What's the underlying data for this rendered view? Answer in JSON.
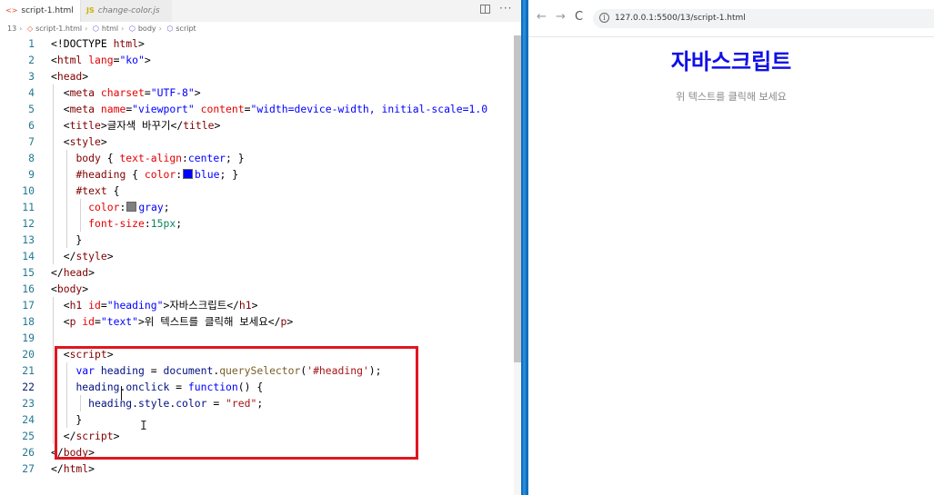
{
  "editor": {
    "tabs": [
      {
        "label": "script-1.html",
        "icon": "html-file-icon",
        "close": "×"
      },
      {
        "label": "change-color.js",
        "icon": "js-file-icon"
      }
    ],
    "breadcrumb": {
      "folder": "13",
      "file": "script-1.html",
      "items": [
        "html",
        "body",
        "script"
      ]
    },
    "active_line": 22,
    "colors": {
      "blue_swatch": "#0000ff",
      "gray_swatch": "#808080",
      "highlight_box": "#e0161f"
    }
  },
  "code_lines": [
    {
      "n": 1,
      "tokens": [
        [
          "p",
          "<!DOCTYPE "
        ],
        [
          "t",
          "html"
        ],
        [
          "p",
          ">"
        ]
      ]
    },
    {
      "n": 2,
      "tokens": [
        [
          "p",
          "<"
        ],
        [
          "t",
          "html"
        ],
        [
          "p",
          " "
        ],
        [
          "a",
          "lang"
        ],
        [
          "p",
          "="
        ],
        [
          "s",
          "\"ko\""
        ],
        [
          "p",
          ">"
        ]
      ]
    },
    {
      "n": 3,
      "tokens": [
        [
          "p",
          "<"
        ],
        [
          "t",
          "head"
        ],
        [
          "p",
          ">"
        ]
      ]
    },
    {
      "n": 4,
      "tokens": [
        [
          "p",
          "  <"
        ],
        [
          "t",
          "meta"
        ],
        [
          "p",
          " "
        ],
        [
          "a",
          "charset"
        ],
        [
          "p",
          "="
        ],
        [
          "s",
          "\"UTF-8\""
        ],
        [
          "p",
          ">"
        ]
      ]
    },
    {
      "n": 5,
      "tokens": [
        [
          "p",
          "  <"
        ],
        [
          "t",
          "meta"
        ],
        [
          "p",
          " "
        ],
        [
          "a",
          "name"
        ],
        [
          "p",
          "="
        ],
        [
          "s",
          "\"viewport\""
        ],
        [
          "p",
          " "
        ],
        [
          "a",
          "content"
        ],
        [
          "p",
          "="
        ],
        [
          "s",
          "\"width=device-width, initial-scale=1.0"
        ]
      ]
    },
    {
      "n": 6,
      "tokens": [
        [
          "p",
          "  <"
        ],
        [
          "t",
          "title"
        ],
        [
          "p",
          ">글자색 바꾸기</"
        ],
        [
          "t",
          "title"
        ],
        [
          "p",
          ">"
        ]
      ]
    },
    {
      "n": 7,
      "tokens": [
        [
          "p",
          "  <"
        ],
        [
          "t",
          "style"
        ],
        [
          "p",
          ">"
        ]
      ]
    },
    {
      "n": 8,
      "tokens": [
        [
          "p",
          "    "
        ],
        [
          "t",
          "body"
        ],
        [
          "p",
          " { "
        ],
        [
          "a",
          "text-align"
        ],
        [
          "p",
          ":"
        ],
        [
          "s",
          "center"
        ],
        [
          "p",
          "; }"
        ]
      ]
    },
    {
      "n": 9,
      "tokens": [
        [
          "p",
          "    "
        ],
        [
          "t",
          "#heading"
        ],
        [
          "p",
          " { "
        ],
        [
          "a",
          "color"
        ],
        [
          "p",
          ":"
        ],
        [
          "sw",
          "blue"
        ],
        [
          "s",
          "blue"
        ],
        [
          "p",
          "; }"
        ]
      ]
    },
    {
      "n": 10,
      "tokens": [
        [
          "p",
          "    "
        ],
        [
          "t",
          "#text"
        ],
        [
          "p",
          " {"
        ]
      ]
    },
    {
      "n": 11,
      "tokens": [
        [
          "p",
          "      "
        ],
        [
          "a",
          "color"
        ],
        [
          "p",
          ":"
        ],
        [
          "sw",
          "gray"
        ],
        [
          "s",
          "gray"
        ],
        [
          "p",
          ";"
        ]
      ]
    },
    {
      "n": 12,
      "tokens": [
        [
          "p",
          "      "
        ],
        [
          "a",
          "font-size"
        ],
        [
          "p",
          ":"
        ],
        [
          "n",
          "15px"
        ],
        [
          "p",
          ";"
        ]
      ]
    },
    {
      "n": 13,
      "tokens": [
        [
          "p",
          "    }"
        ]
      ]
    },
    {
      "n": 14,
      "tokens": [
        [
          "p",
          "  </"
        ],
        [
          "t",
          "style"
        ],
        [
          "p",
          ">"
        ]
      ]
    },
    {
      "n": 15,
      "tokens": [
        [
          "p",
          "</"
        ],
        [
          "t",
          "head"
        ],
        [
          "p",
          ">"
        ]
      ]
    },
    {
      "n": 16,
      "tokens": [
        [
          "p",
          "<"
        ],
        [
          "t",
          "body"
        ],
        [
          "p",
          ">"
        ]
      ]
    },
    {
      "n": 17,
      "tokens": [
        [
          "p",
          "  <"
        ],
        [
          "t",
          "h1"
        ],
        [
          "p",
          " "
        ],
        [
          "a",
          "id"
        ],
        [
          "p",
          "="
        ],
        [
          "s",
          "\"heading\""
        ],
        [
          "p",
          ">자바스크립트</"
        ],
        [
          "t",
          "h1"
        ],
        [
          "p",
          ">"
        ]
      ]
    },
    {
      "n": 18,
      "tokens": [
        [
          "p",
          "  <"
        ],
        [
          "t",
          "p"
        ],
        [
          "p",
          " "
        ],
        [
          "a",
          "id"
        ],
        [
          "p",
          "="
        ],
        [
          "s",
          "\"text\""
        ],
        [
          "p",
          ">위 텍스트를 클릭해 보세요</"
        ],
        [
          "t",
          "p"
        ],
        [
          "p",
          ">"
        ]
      ]
    },
    {
      "n": 19,
      "tokens": []
    },
    {
      "n": 20,
      "tokens": [
        [
          "p",
          "  <"
        ],
        [
          "t",
          "script"
        ],
        [
          "p",
          ">"
        ]
      ]
    },
    {
      "n": 21,
      "tokens": [
        [
          "p",
          "    "
        ],
        [
          "k",
          "var"
        ],
        [
          "p",
          " "
        ],
        [
          "v",
          "heading"
        ],
        [
          "p",
          " = "
        ],
        [
          "v",
          "document"
        ],
        [
          "p",
          "."
        ],
        [
          "f",
          "querySelector"
        ],
        [
          "p",
          "("
        ],
        [
          "str",
          "'#heading'"
        ],
        [
          "p",
          ");"
        ]
      ]
    },
    {
      "n": 22,
      "tokens": [
        [
          "p",
          "    "
        ],
        [
          "v",
          "heading"
        ],
        [
          "p",
          "."
        ],
        [
          "v",
          "onclick"
        ],
        [
          "p",
          " = "
        ],
        [
          "k",
          "function"
        ],
        [
          "p",
          "() {"
        ]
      ]
    },
    {
      "n": 23,
      "tokens": [
        [
          "p",
          "      "
        ],
        [
          "v",
          "heading"
        ],
        [
          "p",
          "."
        ],
        [
          "v",
          "style"
        ],
        [
          "p",
          "."
        ],
        [
          "v",
          "color"
        ],
        [
          "p",
          " = "
        ],
        [
          "str",
          "\"red\""
        ],
        [
          "p",
          ";"
        ]
      ]
    },
    {
      "n": 24,
      "tokens": [
        [
          "p",
          "    }"
        ]
      ]
    },
    {
      "n": 25,
      "tokens": [
        [
          "p",
          "  </"
        ],
        [
          "t",
          "script"
        ],
        [
          "p",
          ">"
        ]
      ]
    },
    {
      "n": 26,
      "tokens": [
        [
          "p",
          "</"
        ],
        [
          "t",
          "body"
        ],
        [
          "p",
          ">"
        ]
      ]
    },
    {
      "n": 27,
      "tokens": [
        [
          "p",
          "</"
        ],
        [
          "t",
          "html"
        ],
        [
          "p",
          ">"
        ]
      ]
    }
  ],
  "browser": {
    "url": "127.0.0.1:5500/13/script-1.html",
    "nav": {
      "back": "←",
      "forward": "→",
      "reload": "C",
      "info": "i"
    },
    "page": {
      "heading": "자바스크립트",
      "paragraph": "위 텍스트를 클릭해 보세요",
      "heading_color": "#1010e6",
      "paragraph_color": "#888888"
    }
  }
}
